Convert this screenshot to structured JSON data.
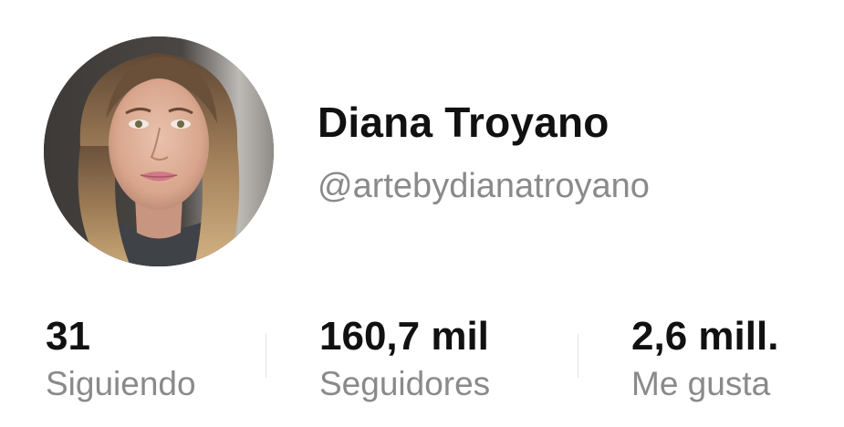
{
  "profile": {
    "display_name": "Diana Troyano",
    "handle": "@artebydianatroyano",
    "avatar_icon": "profile-photo"
  },
  "stats": [
    {
      "value": "31",
      "label": "Siguiendo"
    },
    {
      "value": "160,7 mil",
      "label": "Seguidores"
    },
    {
      "value": "2,6 mill.",
      "label": "Me gusta"
    }
  ],
  "colors": {
    "primary_text": "#111111",
    "secondary_text": "#8a8a8a",
    "divider": "#e3e3e3",
    "background": "#ffffff"
  }
}
